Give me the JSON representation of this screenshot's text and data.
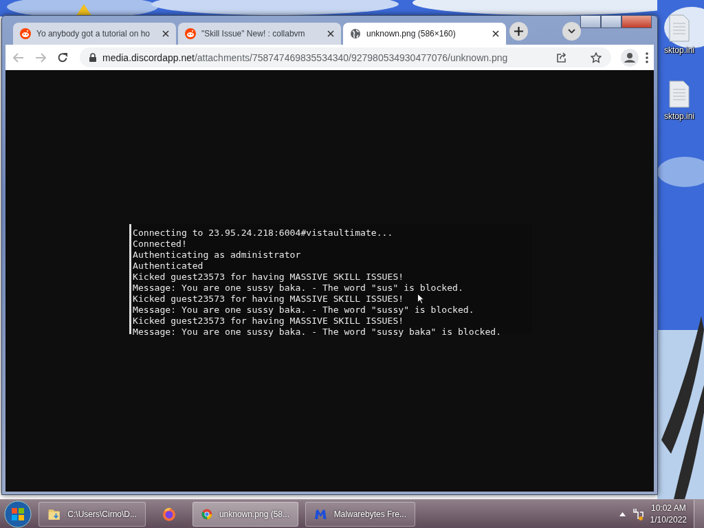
{
  "desktop": {
    "icons": [
      {
        "label": "sktop.ini"
      },
      {
        "label": "sktop.ini"
      }
    ]
  },
  "window": {
    "tabs": [
      {
        "title": "Yo anybody got a tutorial on ho",
        "kind": "reddit",
        "selected": false
      },
      {
        "title": "\"Skill Issue\" New! : collabvm",
        "kind": "reddit",
        "selected": false
      },
      {
        "title": "unknown.png (586×160)",
        "kind": "globe",
        "selected": true
      }
    ],
    "address": {
      "host": "media.discordapp.net",
      "path": "/attachments/758747469835534340/927980534930477076/unknown.png"
    },
    "image_lines": [
      "Connecting to 23.95.24.218:6004#vistaultimate...",
      "Connected!",
      "Authenticating as administrator",
      "Authenticated",
      "Kicked guest23573 for having MASSIVE SKILL ISSUES!",
      "Message: You are one sussy baka. - The word \"sus\" is blocked.",
      "Kicked guest23573 for having MASSIVE SKILL ISSUES!",
      "Message: You are one sussy baka. - The word \"sussy\" is blocked.",
      "Kicked guest23573 for having MASSIVE SKILL ISSUES!",
      "Message: You are one sussy baka. - The word \"sussy baka\" is blocked."
    ]
  },
  "taskbar": {
    "buttons": [
      {
        "kind": "folder",
        "label": "C:\\Users\\Cirno\\D...",
        "selected": false
      },
      {
        "kind": "firefox",
        "selected": false
      },
      {
        "kind": "chrome",
        "label": "unknown.png (58...",
        "selected": true
      },
      {
        "kind": "malwarebytes",
        "label": "Malwarebytes Fre...",
        "selected": false
      }
    ],
    "time": "10:02 AM",
    "date": "1/10/2022"
  }
}
